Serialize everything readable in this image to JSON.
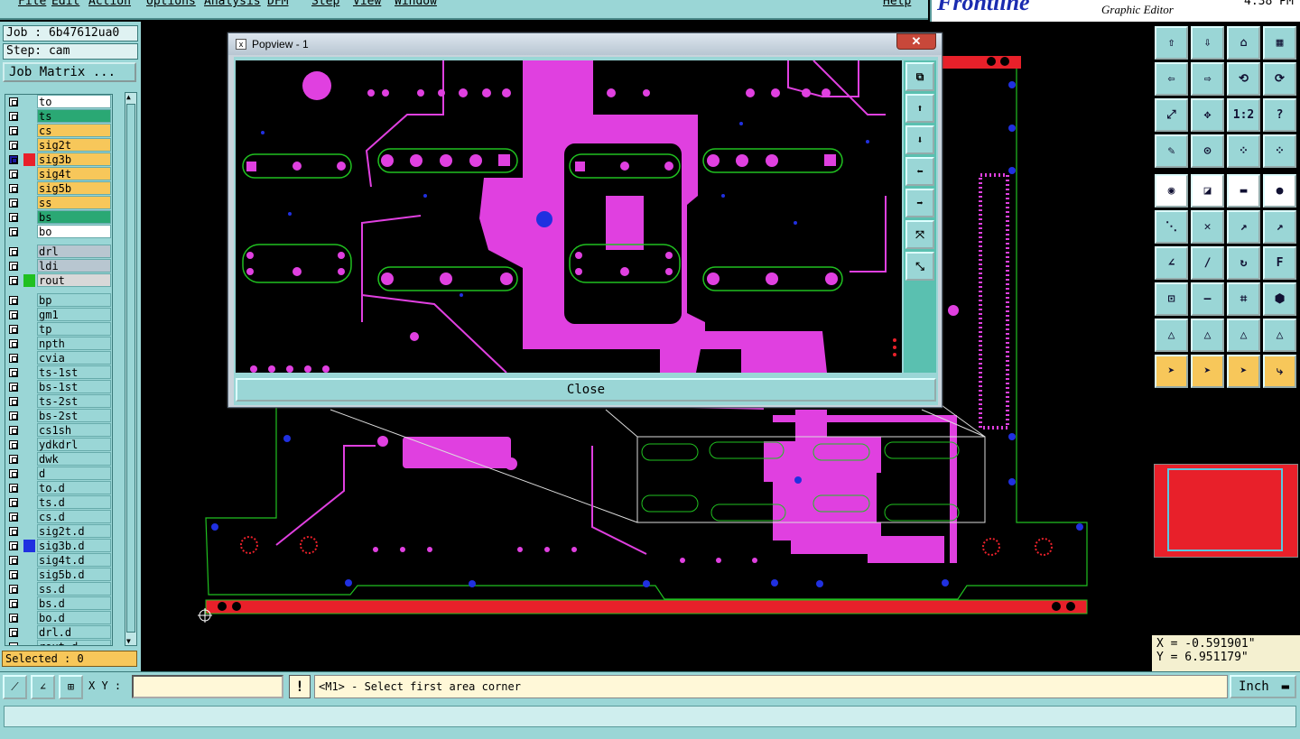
{
  "menubar": {
    "items": [
      "File",
      "Edit",
      "Action",
      "Options",
      "Analysis",
      "DFM",
      "Step",
      "View",
      "Window"
    ],
    "help": "Help"
  },
  "brand": {
    "logo": "Frontline",
    "subtitle": "Graphic Editor",
    "time": "4:38 PM"
  },
  "left": {
    "job": "Job : 6b47612ua0",
    "step": "Step: cam",
    "job_matrix": "Job Matrix ...",
    "layers_group1": [
      {
        "name": "to",
        "color": "#ffffff",
        "swatch": ""
      },
      {
        "name": "ts",
        "color": "#2aa874",
        "swatch": ""
      },
      {
        "name": "cs",
        "color": "#f7c75a",
        "swatch": ""
      },
      {
        "name": "sig2t",
        "color": "#f7c75a",
        "swatch": ""
      },
      {
        "name": "sig3b",
        "color": "#f7c75a",
        "swatch": "#e8202a",
        "checkFill": "#1a1aa0"
      },
      {
        "name": "sig4t",
        "color": "#f7c75a",
        "swatch": ""
      },
      {
        "name": "sig5b",
        "color": "#f7c75a",
        "swatch": ""
      },
      {
        "name": "ss",
        "color": "#f7c75a",
        "swatch": ""
      },
      {
        "name": "bs",
        "color": "#2aa874",
        "swatch": ""
      },
      {
        "name": "bo",
        "color": "#ffffff",
        "swatch": ""
      }
    ],
    "layers_group2": [
      {
        "name": "drl",
        "color": "#b8c6d0",
        "swatch": ""
      },
      {
        "name": "ldi",
        "color": "#b8c6d0",
        "swatch": ""
      },
      {
        "name": "rout",
        "color": "#d8d8d8",
        "swatch": "#20c020"
      }
    ],
    "layers_group3": [
      {
        "name": "bp",
        "color": "#9ad6d6",
        "swatch": ""
      },
      {
        "name": "gm1",
        "color": "#9ad6d6",
        "swatch": ""
      },
      {
        "name": "tp",
        "color": "#9ad6d6",
        "swatch": ""
      },
      {
        "name": "npth",
        "color": "#9ad6d6",
        "swatch": ""
      },
      {
        "name": "cvia",
        "color": "#9ad6d6",
        "swatch": ""
      },
      {
        "name": "ts-1st",
        "color": "#9ad6d6",
        "swatch": ""
      },
      {
        "name": "bs-1st",
        "color": "#9ad6d6",
        "swatch": ""
      },
      {
        "name": "ts-2st",
        "color": "#9ad6d6",
        "swatch": ""
      },
      {
        "name": "bs-2st",
        "color": "#9ad6d6",
        "swatch": ""
      },
      {
        "name": "cs1sh",
        "color": "#9ad6d6",
        "swatch": ""
      },
      {
        "name": "ydkdrl",
        "color": "#9ad6d6",
        "swatch": ""
      },
      {
        "name": "dwk",
        "color": "#9ad6d6",
        "swatch": ""
      },
      {
        "name": "d",
        "color": "#9ad6d6",
        "swatch": ""
      },
      {
        "name": "to.d",
        "color": "#9ad6d6",
        "swatch": ""
      },
      {
        "name": "ts.d",
        "color": "#9ad6d6",
        "swatch": ""
      },
      {
        "name": "cs.d",
        "color": "#9ad6d6",
        "swatch": ""
      },
      {
        "name": "sig2t.d",
        "color": "#9ad6d6",
        "swatch": ""
      },
      {
        "name": "sig3b.d",
        "color": "#9ad6d6",
        "swatch": "#2030e0"
      },
      {
        "name": "sig4t.d",
        "color": "#9ad6d6",
        "swatch": ""
      },
      {
        "name": "sig5b.d",
        "color": "#9ad6d6",
        "swatch": ""
      },
      {
        "name": "ss.d",
        "color": "#9ad6d6",
        "swatch": ""
      },
      {
        "name": "bs.d",
        "color": "#9ad6d6",
        "swatch": ""
      },
      {
        "name": "bo.d",
        "color": "#9ad6d6",
        "swatch": ""
      },
      {
        "name": "drl.d",
        "color": "#9ad6d6",
        "swatch": ""
      },
      {
        "name": "rout.d",
        "color": "#9ad6d6",
        "swatch": ""
      }
    ],
    "selected": "Selected : 0"
  },
  "popview": {
    "title": "Popview - 1",
    "close": "Close"
  },
  "coords": {
    "x": "X = -0.591901\"",
    "y": "Y = 6.951179\""
  },
  "bottom": {
    "xy_label": "X Y :",
    "xy_value": "",
    "prompt": "<M1> - Select first area corner",
    "units": "Inch"
  },
  "icons": {
    "tools": [
      "zoom-home",
      "zoom-down",
      "home",
      "snap",
      "pan-left",
      "pan-right",
      "mirror",
      "step-repeat",
      "fit",
      "center",
      "ratio",
      "help",
      "measure",
      "drill",
      "move-net",
      "move-net2",
      "feature-select",
      "draw-line",
      "ruler",
      "pad",
      "connect",
      "cut",
      "add-arc",
      "add-arc2",
      "slope",
      "slope2",
      "rotate",
      "font",
      "rect-add",
      "horiz-line",
      "copy-link",
      "shapes",
      "tri-1",
      "tri-2",
      "tri-3",
      "tri-4",
      "pointer",
      "pointer-box",
      "pointer-circle",
      "route-net"
    ]
  }
}
